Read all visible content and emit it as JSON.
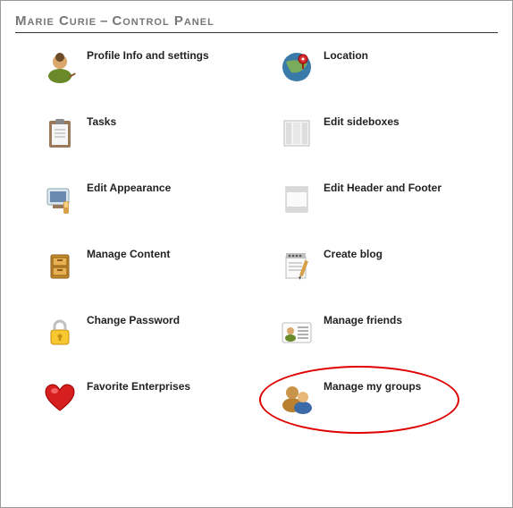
{
  "heading": {
    "name": "Marie Curie",
    "section": "Control Panel"
  },
  "items": [
    {
      "label": "Profile Info and settings"
    },
    {
      "label": "Location"
    },
    {
      "label": "Tasks"
    },
    {
      "label": "Edit sideboxes"
    },
    {
      "label": "Edit Appearance"
    },
    {
      "label": "Edit Header and Footer"
    },
    {
      "label": "Manage Content"
    },
    {
      "label": "Create blog"
    },
    {
      "label": "Change Password"
    },
    {
      "label": "Manage friends"
    },
    {
      "label": "Favorite Enterprises"
    },
    {
      "label": "Manage my groups"
    }
  ],
  "highlighted_index": 11
}
